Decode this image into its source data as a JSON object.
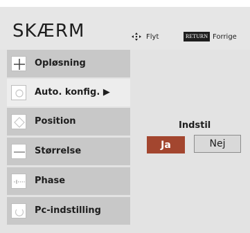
{
  "header": {
    "title": "SKÆRM",
    "move_hint": "Flyt",
    "return_key": "RETURN",
    "return_hint": "Forrige"
  },
  "menu": {
    "items": [
      {
        "label": "Opløsning",
        "icon": "plus-icon"
      },
      {
        "label": "Auto. konfig. ▶",
        "icon": "auto-config-icon",
        "selected": true
      },
      {
        "label": "Position",
        "icon": "position-icon"
      },
      {
        "label": "Størrelse",
        "icon": "size-icon"
      },
      {
        "label": "Phase",
        "icon": "phase-icon"
      },
      {
        "label": "Pc-indstilling",
        "icon": "pc-setting-icon"
      }
    ]
  },
  "set_panel": {
    "title": "Indstil",
    "yes_label": "Ja",
    "no_label": "Nej"
  },
  "colors": {
    "accent": "#a3462f",
    "menu_item": "#c8c8c8",
    "menu_item_selected": "#ededed",
    "header_bg": "#e6e6e6"
  }
}
